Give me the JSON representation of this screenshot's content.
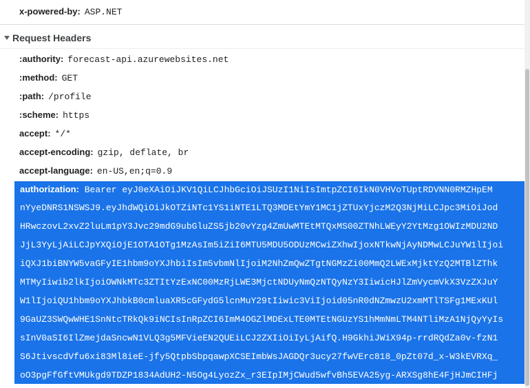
{
  "response_headers": {
    "last_row": {
      "name": "x-powered-by:",
      "value": "ASP.NET"
    }
  },
  "request_headers": {
    "title": "Request Headers",
    "rows": [
      {
        "name": ":authority:",
        "value": "forecast-api.azurewebsites.net"
      },
      {
        "name": ":method:",
        "value": "GET"
      },
      {
        "name": ":path:",
        "value": "/profile"
      },
      {
        "name": ":scheme:",
        "value": "https"
      },
      {
        "name": "accept:",
        "value": "*/*"
      },
      {
        "name": "accept-encoding:",
        "value": "gzip, deflate, br"
      },
      {
        "name": "accept-language:",
        "value": "en-US,en;q=0.9"
      }
    ],
    "authorization": {
      "name": "authorization:",
      "first_line": "Bearer eyJ0eXAiOiJKV1QiLCJhbGciOiJSUzI1NiIsImtpZCI6IkN0VHVoTUptRDVNN0RMZHpEM",
      "continuation_lines": [
        "nYyeDNRS1NSWSJ9.eyJhdWQiOiJkOTZiNTc1YS1iNTE1LTQ3MDEtYmY1MC1jZTUxYjczM2Q3NjMiLCJpc3MiOiJod",
        "HRwczovL2xvZ2luLm1pY3Jvc29mdG9ubGluZS5jb20vYzg4ZmUwMTEtMTQxMS00ZTNhLWEyY2YtMzg1OWIzMDU2ND",
        "JjL3YyLjAiLCJpYXQiOjE1OTA1OTg1MzAsIm5iZiI6MTU5MDU5ODUzMCwiZXhwIjoxNTkwNjAyNDMwLCJuYW1lIjoi",
        "iQXJ1biBNYW5vaGFyIE1hbm9oYXJhbiIsIm5vbmNlIjoiM2NhZmQwZTgtNGMzZi00MmQ2LWExMjktYzQ2MTBlZThk",
        "MTMyIiwib2lkIjoiOWNkMTc3ZTItYzExNC00MzRjLWE3MjctNDUyNmQzNTQyNzY3IiwicHJlZmVycmVkX3VzZXJuY",
        "W1lIjoiQU1hbm9oYXJhbkB0cmluaXR5cGFydG5lcnMuY29tIiwic3ViIjoid05nR0dNZmwzU2xmMTlTSFg1MExKUl",
        "9GaUZ3SWQwWHE1SnNtcTRkQk9iNCIsInRpZCI6ImM4OGZlMDExLTE0MTEtNGUzYS1hMmNmLTM4NTliMzA1NjQyYyIs",
        "sInV0aSI6IlZmejdaSncwN1VLQ3g5MFVieEN2QUEiLCJ2ZXIiOiIyLjAifQ.H9GkhiJWiX94p-rrdRQdZa0v-fzN1",
        "S6JtivscdVfu6xi83Ml8ieE-jfy5QtpbSbpqawpXCSEImbWsJAGDQr3ucy27fwVErc818_0pZt07d_x-W3kEVRXq_",
        "oO3pgFfGftVMUkgd9TDZP1834AdUH2-N5Og4LyozZx_r3EIpIMjCWud5wfvBh5EVA25yg-ARXSg8hE4FjHJmCIHFj"
      ]
    }
  }
}
